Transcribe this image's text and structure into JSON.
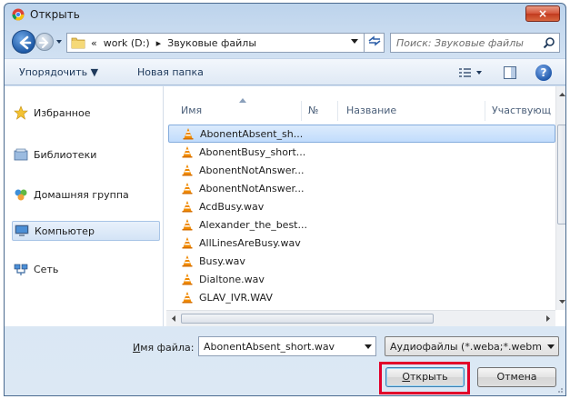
{
  "window": {
    "title": "Открыть",
    "close_icon": "×"
  },
  "address": {
    "crumbs_prefix": "«",
    "drive": "work (D:)",
    "separator": "▸",
    "folder": "Звуковые файлы"
  },
  "search": {
    "placeholder": "Поиск: Звуковые файлы"
  },
  "toolbar": {
    "organize_label": "Упорядочить ▼",
    "new_folder_label": "Новая папка",
    "help_label": "?"
  },
  "sidebar": {
    "items": [
      {
        "label": "Избранное",
        "icon": "star-icon"
      },
      {
        "label": "Библиотеки",
        "icon": "library-icon"
      },
      {
        "label": "Домашняя группа",
        "icon": "homegroup-icon"
      },
      {
        "label": "Компьютер",
        "icon": "computer-icon"
      },
      {
        "label": "Сеть",
        "icon": "network-icon"
      }
    ],
    "selected_index": 3
  },
  "columns": {
    "name": "Имя",
    "number": "№",
    "title": "Название",
    "artists": "Участвующ"
  },
  "files": [
    "AbonentAbsent_sh...",
    "AbonentBusy_short...",
    "AbonentNotAnswer...",
    "AbonentNotAnswer...",
    "AcdBusy.wav",
    "Alexander_the_best...",
    "AllLinesAreBusy.wav",
    "Busy.wav",
    "Dialtone.wav",
    "GLAV_IVR.WAV"
  ],
  "selected_file_index": 0,
  "bottom": {
    "filename_label_prefix": "",
    "filename_label_ul": "И",
    "filename_label_rest": "мя файла:",
    "filename_value": "AbonentAbsent_short.wav",
    "filter_value": "Аудиофайлы (*.weba;*.webm;*",
    "open_label_ul": "О",
    "open_label_rest": "ткрыть",
    "cancel_label": "Отмена"
  },
  "colors": {
    "highlight": "#e2002a",
    "vlc_orange": "#f08a00"
  }
}
